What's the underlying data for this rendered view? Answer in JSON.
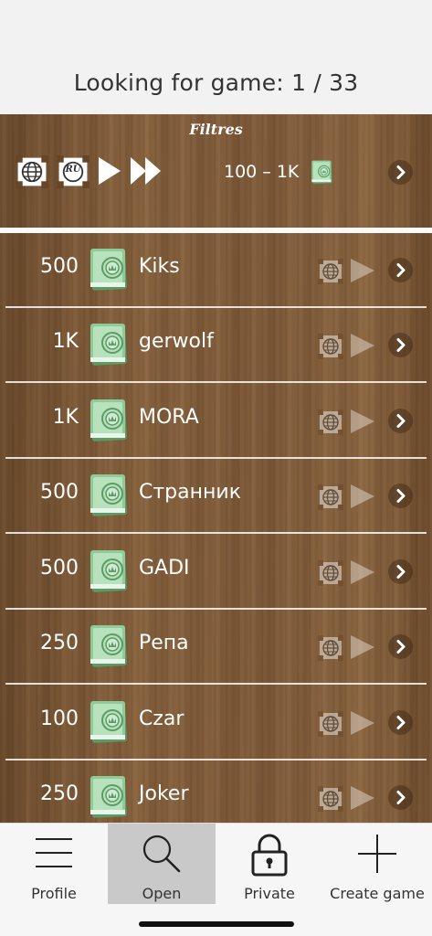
{
  "header": {
    "title": "Looking for game: 1 / 33"
  },
  "filters": {
    "title": "Filtres",
    "lang_badge": "RU",
    "range": "100 – 1K",
    "icons": [
      "globe-icon",
      "language-ru-icon",
      "play-icon",
      "fast-forward-icon",
      "money-icon",
      "chevron-right-icon"
    ]
  },
  "games": [
    {
      "stake": "500",
      "player": "Kiks"
    },
    {
      "stake": "1K",
      "player": "gerwolf"
    },
    {
      "stake": "1K",
      "player": "MORA"
    },
    {
      "stake": "500",
      "player": "Странник"
    },
    {
      "stake": "500",
      "player": "GADI"
    },
    {
      "stake": "250",
      "player": "Репа"
    },
    {
      "stake": "100",
      "player": "Czar"
    },
    {
      "stake": "250",
      "player": "Joker"
    }
  ],
  "tabs": [
    {
      "label": "Profile",
      "icon": "menu-icon",
      "active": false
    },
    {
      "label": "Open",
      "icon": "search-icon",
      "active": true
    },
    {
      "label": "Private",
      "icon": "lock-icon",
      "active": false
    },
    {
      "label": "Create game",
      "icon": "plus-icon",
      "active": false
    }
  ],
  "colors": {
    "wood": "#7a5634",
    "money_green": "#7fc089",
    "active_tab": "#c9c9c9"
  }
}
